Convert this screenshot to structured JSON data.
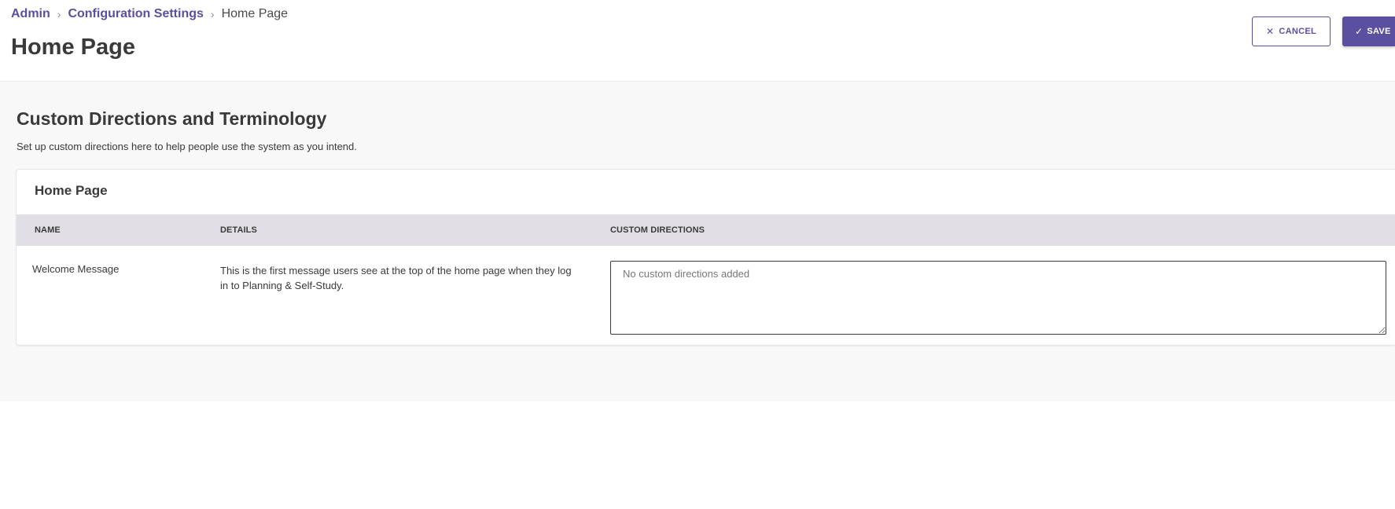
{
  "breadcrumb": {
    "items": [
      "Admin",
      "Configuration Settings"
    ],
    "separator": "›",
    "current": "Home Page"
  },
  "page": {
    "title": "Home Page"
  },
  "actions": {
    "cancel_label": "CANCEL",
    "save_label": "SAVE",
    "cancel_icon": "close-icon",
    "save_icon": "check-icon"
  },
  "section": {
    "title": "Custom Directions and Terminology",
    "description": "Set up custom directions here to help people use the system as you intend."
  },
  "card": {
    "title": "Home Page",
    "columns": [
      "NAME",
      "DETAILS",
      "CUSTOM DIRECTIONS"
    ],
    "rows": [
      {
        "name": "Welcome Message",
        "details": "This is the first message users see at the top of the home page when they log in to Planning & Self-Study.",
        "custom_directions_value": "",
        "custom_directions_placeholder": "No custom directions added"
      }
    ]
  },
  "colors": {
    "accent": "#5b4fa0",
    "table_header_bg": "#e1dfe5",
    "content_bg": "#f8f8f8"
  }
}
